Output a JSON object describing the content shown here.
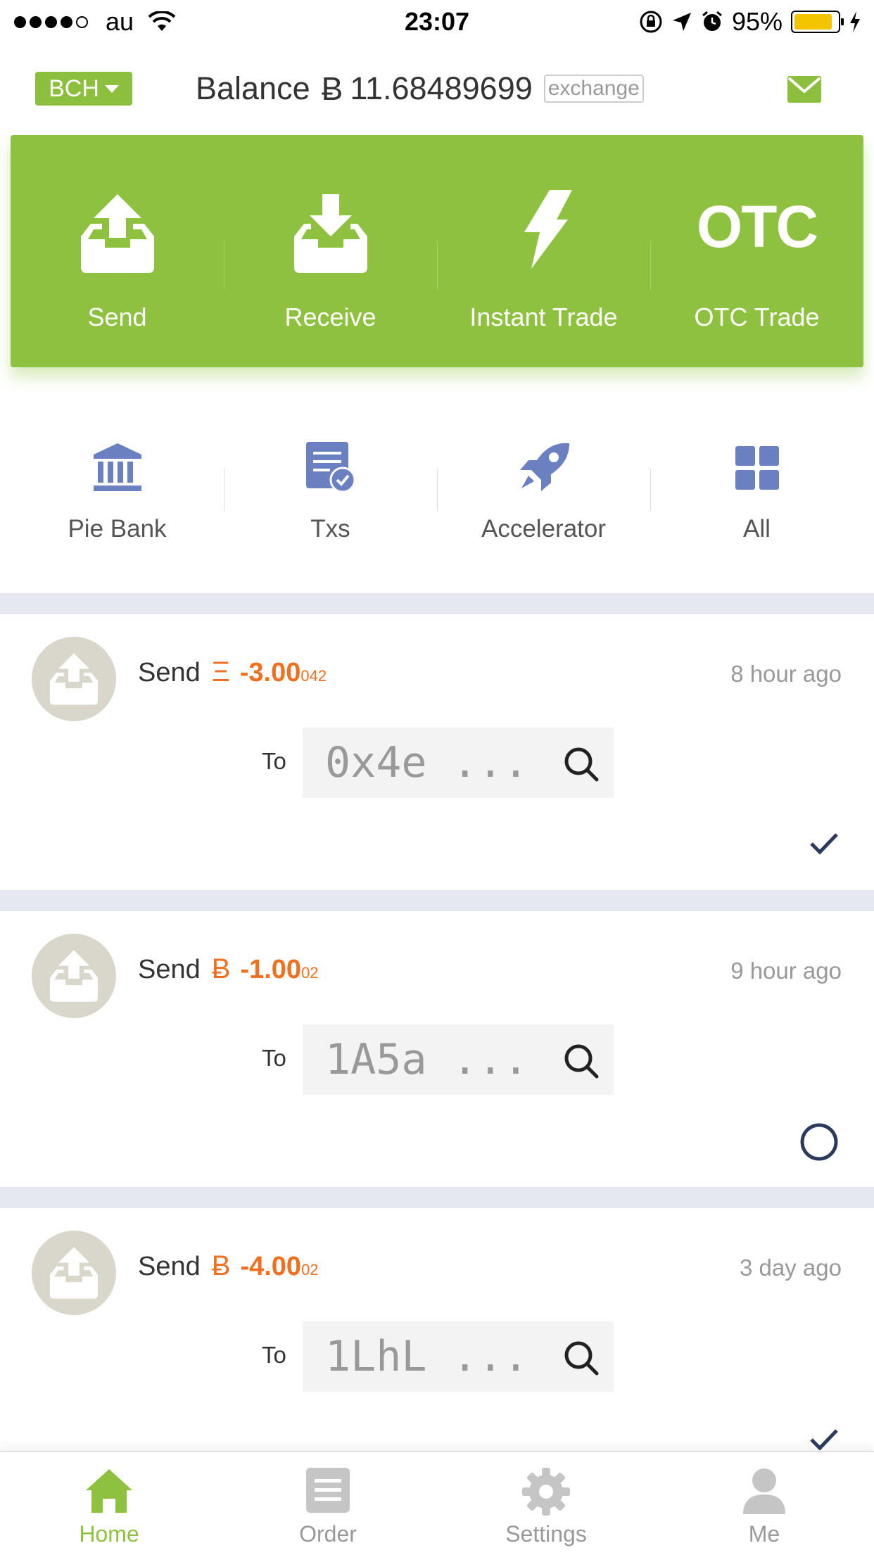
{
  "status_bar": {
    "carrier": "au",
    "time": "23:07",
    "battery": "95%",
    "battery_level": 0.95
  },
  "header": {
    "coin_selector": "BCH",
    "balance_label": "Balance",
    "balance_symbol": "Ƀ",
    "balance_value": "11.68489699",
    "exchange_label": "exchange"
  },
  "actions": [
    {
      "label": "Send",
      "icon": "send-tray-icon"
    },
    {
      "label": "Receive",
      "icon": "receive-tray-icon"
    },
    {
      "label": "Instant Trade",
      "icon": "lightning-icon"
    },
    {
      "label": "OTC Trade",
      "icon": "otc-text-icon",
      "icon_text": "OTC"
    }
  ],
  "shortcuts": [
    {
      "label": "Pie Bank",
      "icon": "bank-icon"
    },
    {
      "label": "Txs",
      "icon": "document-check-icon"
    },
    {
      "label": "Accelerator",
      "icon": "rocket-icon"
    },
    {
      "label": "All",
      "icon": "grid-icon"
    }
  ],
  "transactions": [
    {
      "type": "Send",
      "coin_symbol": "Ξ",
      "amount_main": "-3.00",
      "amount_small": "042",
      "time": "8 hour ago",
      "to_label": "To",
      "address": "0x4e ...",
      "status": "confirmed"
    },
    {
      "type": "Send",
      "coin_symbol": "Ƀ",
      "amount_main": "-1.00",
      "amount_small": "02",
      "time": "9 hour ago",
      "to_label": "To",
      "address": "1A5a ...",
      "status": "pending"
    },
    {
      "type": "Send",
      "coin_symbol": "Ƀ",
      "amount_main": "-4.00",
      "amount_small": "02",
      "time": "3 day ago",
      "to_label": "To",
      "address": "1LhL ...",
      "status": "confirmed"
    }
  ],
  "tabbar": [
    {
      "label": "Home",
      "icon": "home-icon",
      "active": true
    },
    {
      "label": "Order",
      "icon": "order-icon",
      "active": false
    },
    {
      "label": "Settings",
      "icon": "gear-icon",
      "active": false
    },
    {
      "label": "Me",
      "icon": "person-icon",
      "active": false
    }
  ],
  "colors": {
    "brand_green": "#8ec13f",
    "amount_orange": "#f07020",
    "icon_blue": "#6b80c0",
    "status_navy": "#2c3a5e"
  }
}
